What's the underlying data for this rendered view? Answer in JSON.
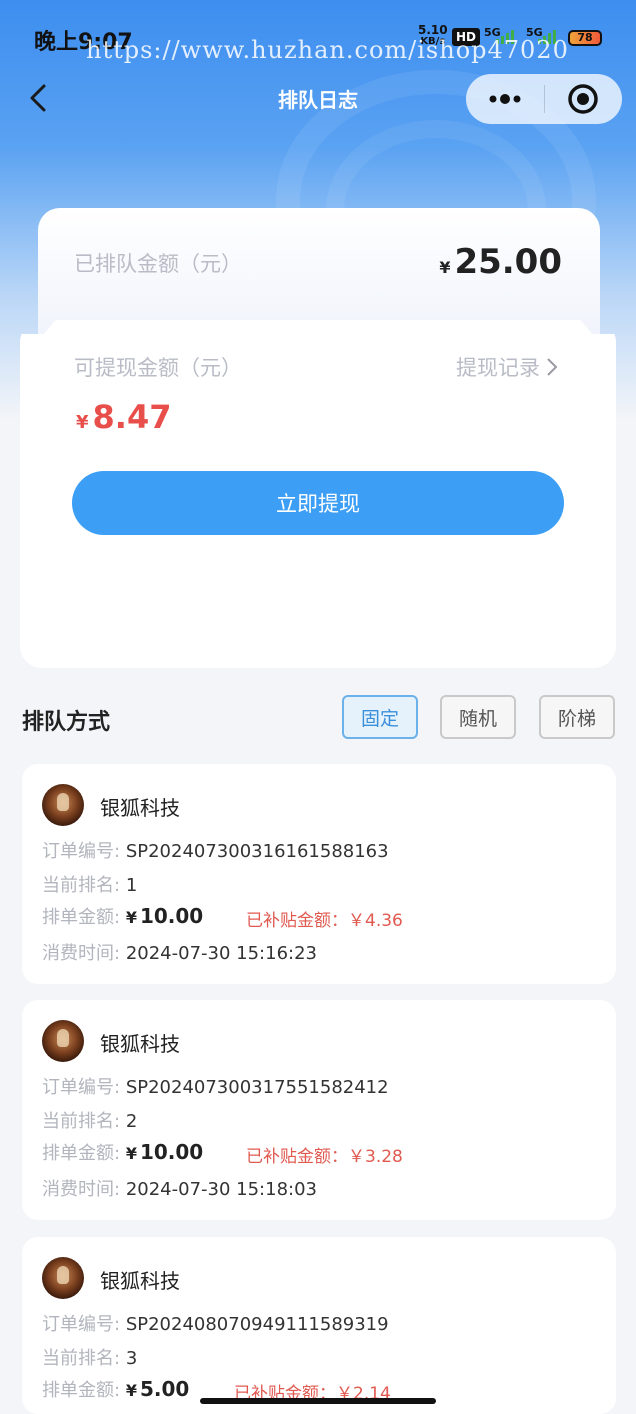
{
  "status_bar": {
    "time": "晚上9:07",
    "net_speed": "5.10",
    "net_unit": "KB/s",
    "hd": "HD",
    "signal1": "5G",
    "signal2": "5G",
    "battery": "78"
  },
  "watermark": "https://www.huzhan.com/ishop47020",
  "nav": {
    "title": "排队日志"
  },
  "queue": {
    "label": "已排队金额（元）",
    "currency": "¥",
    "amount": "25.00"
  },
  "withdraw": {
    "label": "可提现金额（元）",
    "record_link": "提现记录",
    "currency": "¥",
    "amount": "8.47",
    "button": "立即提现"
  },
  "mode": {
    "title": "排队方式",
    "options": [
      "固定",
      "随机",
      "阶梯"
    ],
    "selected": "固定"
  },
  "orders": [
    {
      "shop": "银狐科技",
      "order_label": "订单编号:",
      "order_no": "SP20240730031616158816​3",
      "rank_label": "当前排名:",
      "rank": "1",
      "amount_label": "排单金额:",
      "currency": "¥",
      "amount": "10.00",
      "subsidy": "已补贴金额：￥4.36",
      "time_label": "消费时间:",
      "time": "2024-07-30 15:16:23"
    },
    {
      "shop": "银狐科技",
      "order_label": "订单编号:",
      "order_no": "SP202407300317551582412",
      "rank_label": "当前排名:",
      "rank": "2",
      "amount_label": "排单金额:",
      "currency": "¥",
      "amount": "10.00",
      "subsidy": "已补贴金额：￥3.28",
      "time_label": "消费时间:",
      "time": "2024-07-30 15:18:03"
    },
    {
      "shop": "银狐科技",
      "order_label": "订单编号:",
      "order_no": "SP202408070949111589319",
      "rank_label": "当前排名:",
      "rank": "3",
      "amount_label": "排单金额:",
      "currency": "¥",
      "amount": "5.00",
      "subsidy": "已补贴金额：￥2.14"
    }
  ],
  "colors": {
    "accent": "#3c9ef5",
    "amount_red": "#e84f4a",
    "selected_border": "#6bb1ea"
  }
}
